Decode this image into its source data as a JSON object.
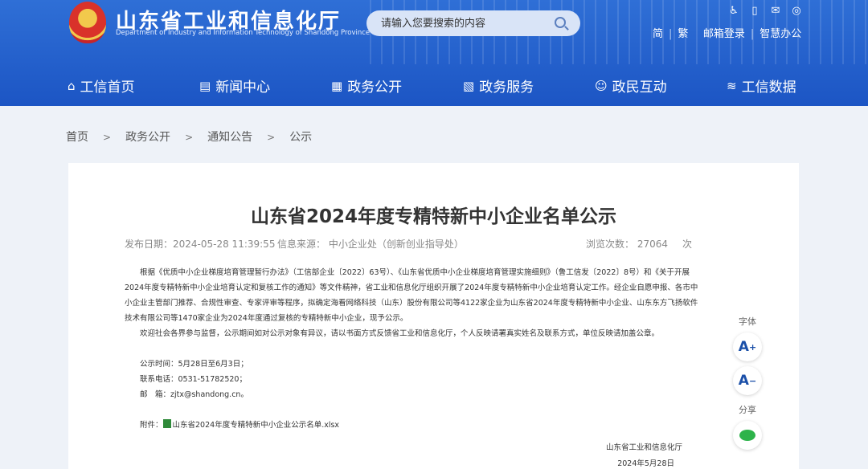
{
  "header": {
    "title": "山东省工业和信息化厅",
    "subtitle": "Department of Industry and Information Technology of Shandong Province",
    "search_placeholder": "请输入您要搜索的内容",
    "tools": [
      "♿",
      "▯",
      "✉",
      "◎"
    ],
    "links": [
      "简",
      "繁",
      "邮箱登录",
      "智慧办公"
    ]
  },
  "nav": [
    {
      "icon": "⌂",
      "label": "工信首页"
    },
    {
      "icon": "▤",
      "label": "新闻中心"
    },
    {
      "icon": "▦",
      "label": "政务公开"
    },
    {
      "icon": "▧",
      "label": "政务服务"
    },
    {
      "icon": "☺",
      "label": "政民互动"
    },
    {
      "icon": "≋",
      "label": "工信数据"
    }
  ],
  "breadcrumb": [
    "首页",
    "政务公开",
    "通知公告",
    "公示"
  ],
  "article": {
    "title": "山东省2024年度专精特新中小企业名单公示",
    "publish_date": "发布日期：2024-05-28 11:39:55",
    "source": "信息来源： 中小企业处（创新创业指导处）",
    "views_label": "浏览次数：",
    "views": "27064",
    "views_unit": "次",
    "para1": "根据《优质中小企业梯度培育管理暂行办法》（工信部企业〔2022〕63号）、《山东省优质中小企业梯度培育管理实施细则》（鲁工信发〔2022〕8号）和《关于开展2024年度专精特新中小企业培育认定和复核工作的通知》等文件精神，省工业和信息化厅组织开展了2024年度专精特新中小企业培育认定工作。经企业自愿申报、各市中小企业主管部门推荐、合规性审查、专家评审等程序，拟确定海看网络科技（山东）股份有限公司等4122家企业为山东省2024年度专精特新中小企业、山东东方飞扬软件技术有限公司等1470家企业为2024年度通过复核的专精特新中小企业，现予公示。",
    "para2": "欢迎社会各界参与监督，公示期间如对公示对象有异议，请以书面方式反馈省工业和信息化厅，个人反映请署真实姓名及联系方式，单位反映请加盖公章。",
    "period": "公示时间：5月28日至6月3日；",
    "phone": "联系电话：0531-51782520；",
    "email": "邮　箱：zjtx@shandong.cn。",
    "attach_label": "附件：",
    "attach_file": "山东省2024年度专精特新中小企业公示名单.xlsx",
    "sign_org": "山东省工业和信息化厅",
    "sign_date": "2024年5月28日"
  },
  "side": {
    "font_label": "字体",
    "font_up": "A",
    "font_up_sup": "+",
    "font_down": "A",
    "font_down_sup": "−",
    "share_label": "分享"
  }
}
